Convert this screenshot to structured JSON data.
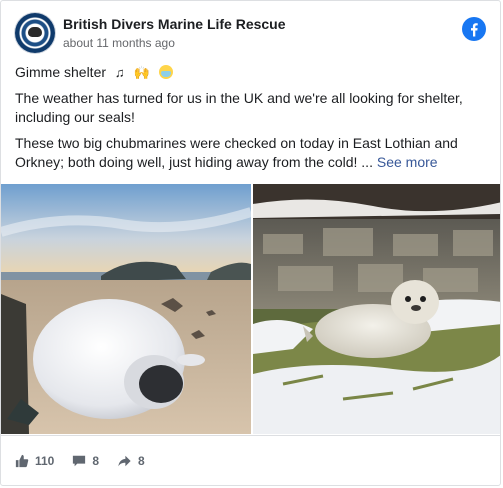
{
  "post": {
    "page_name": "British Divers Marine Life Rescue",
    "timestamp": "about 11 months ago",
    "avatar_text": "BRITISH DIVERS MARINE LIFE RESCUE",
    "title_line": "Gimme shelter",
    "title_emojis": [
      "musical-note",
      "hands-raised",
      "face-mask"
    ],
    "paragraph_1": "The weather has turned for us in the UK and we're all looking for shelter, including our seals!",
    "paragraph_2": "These two big chubmarines were checked on today in East Lothian and Orkney; both doing well, just hiding away from the cold! ...",
    "see_more": "See more"
  },
  "photos": [
    {
      "subject": "seal pup lying on beach at sunset"
    },
    {
      "subject": "seal pup on snowy grass"
    }
  ],
  "footer": {
    "likes": "110",
    "comments": "8",
    "shares": "8"
  },
  "colors": {
    "facebook_blue": "#1877f2",
    "link": "#385898",
    "muted": "#65676b"
  }
}
